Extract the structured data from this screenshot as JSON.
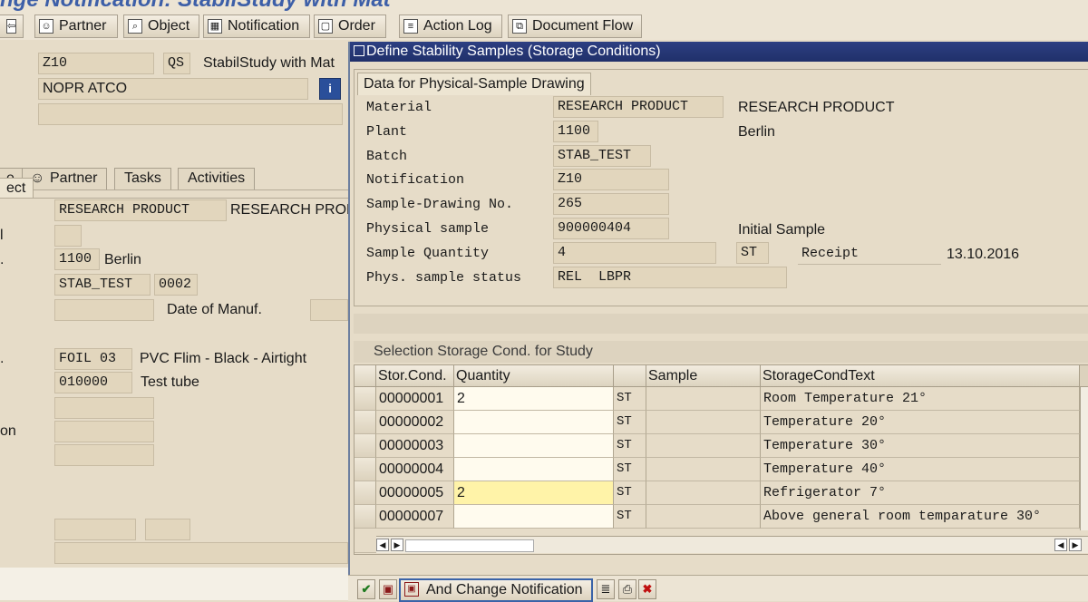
{
  "window": {
    "title": "nge Notification: StabilStudy with Mat"
  },
  "toolbar": {
    "buttons": [
      {
        "label": "Partner"
      },
      {
        "label": "Object"
      },
      {
        "label": "Notification"
      },
      {
        "label": "Order"
      },
      {
        "label": "Action Log"
      },
      {
        "label": "Document Flow"
      }
    ]
  },
  "left": {
    "notif_type": "Z10",
    "priority": "QS",
    "notif_desc": "StabilStudy with Mat",
    "reporter": "NOPR ATCO",
    "tabs": [
      "e",
      "Partner",
      "Tasks",
      "Activities"
    ],
    "section": "ect",
    "material_code": "RESEARCH PRODUCT",
    "material_text": "RESEARCH PRODU",
    "row_l1": "l",
    "plant_label": ".",
    "plant": "1100",
    "plant_text": "Berlin",
    "batch": "STAB_TEST",
    "batch_num": "0002",
    "date_manuf": "Date of Manuf.",
    "pkg_label": ".",
    "pkg": "FOIL 03",
    "pkg_text": "PVC Flim - Black - Airtight",
    "container": "010000",
    "container_text": "Test tube",
    "row_on": "on"
  },
  "popup": {
    "title": "Define Stability Samples (Storage Conditions)",
    "group_title": "Data for Physical-Sample Drawing",
    "fields": {
      "material_label": "Material",
      "material": "RESEARCH PRODUCT",
      "material_text": "RESEARCH PRODUCT",
      "plant_label": "Plant",
      "plant": "1100",
      "plant_text": "Berlin",
      "batch_label": "Batch",
      "batch": "STAB_TEST",
      "notif_label": "Notification",
      "notif": "Z10",
      "sdn_label": "Sample-Drawing No.",
      "sdn": "265",
      "phys_label": "Physical sample",
      "phys": "900000404",
      "phys_text": "Initial Sample",
      "qty_label": "Sample Quantity",
      "qty": "4",
      "unit": "ST",
      "receipt_label": "Receipt",
      "receipt": "13.10.2016",
      "status_label": "Phys. sample status",
      "status": "REL  LBPR"
    },
    "table_title": "Selection Storage Cond. for Study",
    "columns": [
      "Stor.Cond.",
      "Quantity",
      "",
      "Sample",
      "StorageCondText"
    ],
    "rows": [
      {
        "cond": "00000001",
        "qty": "2",
        "unit": "ST",
        "sample": "",
        "text": "Room Temperature 21°"
      },
      {
        "cond": "00000002",
        "qty": "",
        "unit": "ST",
        "sample": "",
        "text": "Temperature 20°"
      },
      {
        "cond": "00000003",
        "qty": "",
        "unit": "ST",
        "sample": "",
        "text": "Temperature 30°"
      },
      {
        "cond": "00000004",
        "qty": "",
        "unit": "ST",
        "sample": "",
        "text": "Temperature 40°"
      },
      {
        "cond": "00000005",
        "qty": "2",
        "unit": "ST",
        "sample": "",
        "text": "Refrigerator 7°"
      },
      {
        "cond": "00000007",
        "qty": "",
        "unit": "ST",
        "sample": "",
        "text": "Above general room temparature 30°"
      }
    ],
    "footer_button": "And Change Notification"
  },
  "colors": {
    "title_blue": "#3d5fa8",
    "popup_title": "#20306a",
    "highlight": "#fff3a8",
    "input_bg": "#fffbee"
  }
}
